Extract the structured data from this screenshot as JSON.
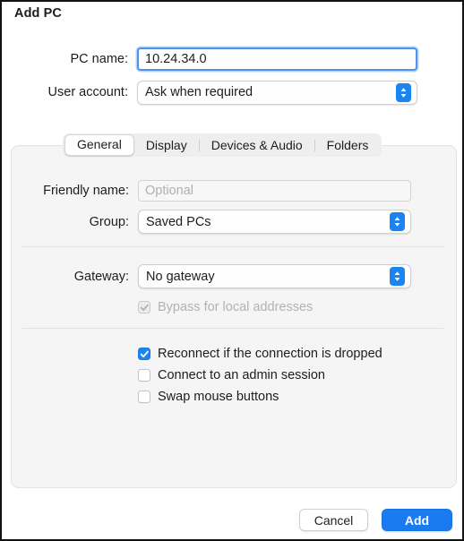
{
  "window": {
    "title": "Add PC"
  },
  "top_form": {
    "pc_name": {
      "label": "PC name:",
      "value": "10.24.34.0",
      "placeholder": ""
    },
    "user_account": {
      "label": "User account:",
      "value": "Ask when required"
    }
  },
  "tabs": [
    {
      "label": "General",
      "active": true
    },
    {
      "label": "Display",
      "active": false
    },
    {
      "label": "Devices & Audio",
      "active": false
    },
    {
      "label": "Folders",
      "active": false
    }
  ],
  "general_tab": {
    "friendly_name": {
      "label": "Friendly name:",
      "value": "",
      "placeholder": "Optional"
    },
    "group": {
      "label": "Group:",
      "value": "Saved PCs"
    },
    "gateway": {
      "label": "Gateway:",
      "value": "No gateway"
    },
    "bypass_local": {
      "label": "Bypass for local addresses",
      "checked": true,
      "enabled": false
    },
    "options": [
      {
        "label": "Reconnect if the connection is dropped",
        "checked": true
      },
      {
        "label": "Connect to an admin session",
        "checked": false
      },
      {
        "label": "Swap mouse buttons",
        "checked": false
      }
    ]
  },
  "footer": {
    "cancel_label": "Cancel",
    "add_label": "Add"
  },
  "colors": {
    "accent_blue": "#1a7bf0",
    "stepper_blue": "#1a84f0",
    "focus_ring": "#4f93f2",
    "panel_background": "#f5f5f5",
    "window_background": "#ffffff",
    "separator": "#e1e1e1",
    "text": "#1d1d1f",
    "muted_text": "#b2b2b4"
  }
}
